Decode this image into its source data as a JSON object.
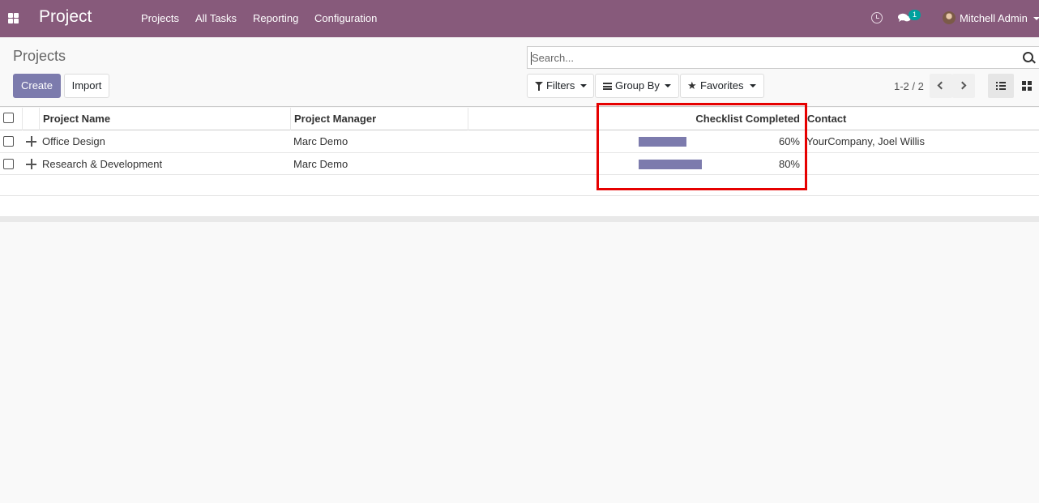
{
  "navbar": {
    "brand": "Project",
    "menu": [
      "Projects",
      "All Tasks",
      "Reporting",
      "Configuration"
    ],
    "chat_badge": "1",
    "user_name": "Mitchell Admin"
  },
  "control_panel": {
    "breadcrumb": "Projects",
    "create_label": "Create",
    "import_label": "Import",
    "search_placeholder": "Search...",
    "filters_label": "Filters",
    "groupby_label": "Group By",
    "favorites_label": "Favorites",
    "pager_value": "1-2 / 2"
  },
  "table": {
    "columns": {
      "name": "Project Name",
      "manager": "Project Manager",
      "checklist": "Checklist Completed",
      "contact": "Contact"
    },
    "rows": [
      {
        "name": "Office Design",
        "manager": "Marc Demo",
        "checklist_percent": 60,
        "checklist_label": "60%",
        "contact": "YourCompany, Joel Willis"
      },
      {
        "name": "Research & Development",
        "manager": "Marc Demo",
        "checklist_percent": 80,
        "checklist_label": "80%",
        "contact": ""
      }
    ]
  },
  "colors": {
    "navbar": "#875a7b",
    "primary": "#7c7bad",
    "highlight": "#e60000"
  }
}
